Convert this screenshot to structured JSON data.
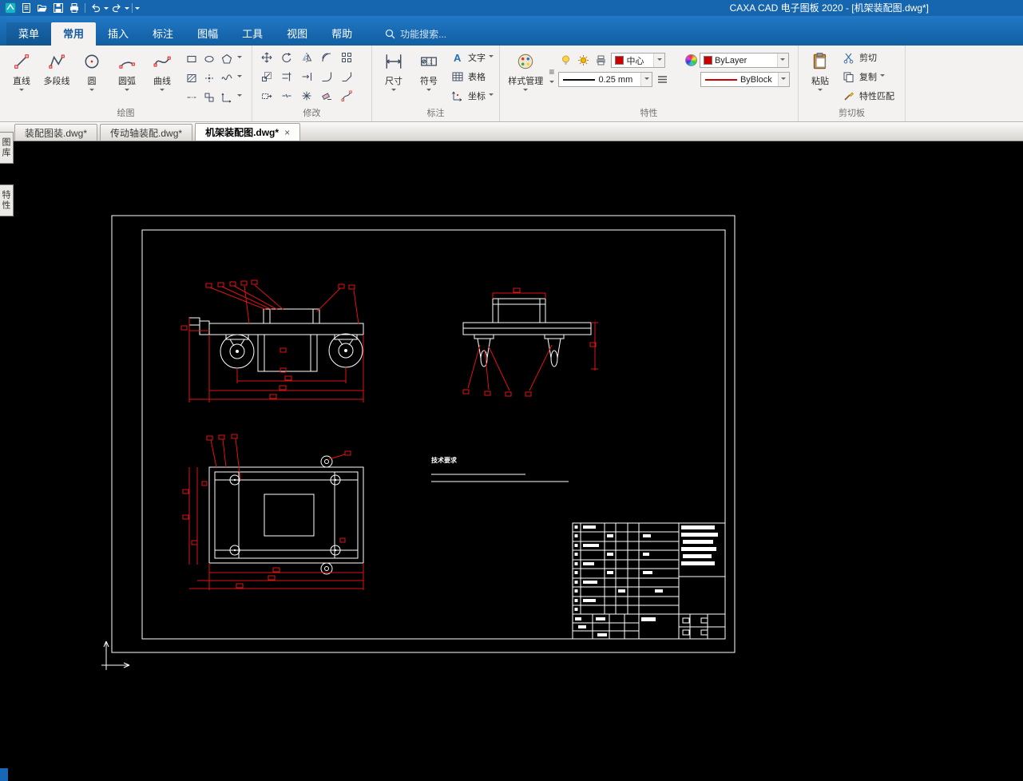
{
  "window": {
    "title": "CAXA CAD 电子图板 2020 - [机架装配图.dwg*]"
  },
  "menu": {
    "tabs": [
      {
        "label": "菜单"
      },
      {
        "label": "常用"
      },
      {
        "label": "插入"
      },
      {
        "label": "标注"
      },
      {
        "label": "图幅"
      },
      {
        "label": "工具"
      },
      {
        "label": "视图"
      },
      {
        "label": "帮助"
      }
    ],
    "search_placeholder": "功能搜索..."
  },
  "ribbon": {
    "draw": {
      "label": "绘图",
      "tools": [
        {
          "label": "直线"
        },
        {
          "label": "多段线"
        },
        {
          "label": "圆"
        },
        {
          "label": "圆弧"
        },
        {
          "label": "曲线"
        }
      ]
    },
    "modify": {
      "label": "修改"
    },
    "annotate": {
      "label": "标注",
      "dimension": "尺寸",
      "symbol": "符号",
      "text": "文字",
      "table": "表格",
      "coordinate": "坐标"
    },
    "properties": {
      "label": "特性",
      "style_manager": "样式管理",
      "color_value": "中心",
      "linewidth_value": "0.25 mm",
      "layer_value": "ByLayer",
      "linetype_value": "ByBlock"
    },
    "clipboard": {
      "label": "剪切板",
      "paste": "粘贴",
      "cut": "剪切",
      "copy": "复制",
      "match": "特性匹配"
    }
  },
  "doc_tabs": [
    {
      "label": "装配图装.dwg*"
    },
    {
      "label": "传动轴装配.dwg*"
    },
    {
      "label": "机架装配图.dwg*",
      "close": "×"
    }
  ],
  "side_panel": {
    "tabs": [
      {
        "label": "图库"
      },
      {
        "label": "特性"
      }
    ]
  },
  "canvas": {
    "tech_note": "技术要求",
    "colors": {
      "background": "#000000",
      "lines": "#ffffff",
      "dimensions": "#e01212"
    }
  }
}
